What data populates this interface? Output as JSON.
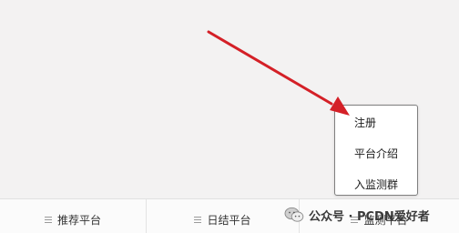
{
  "popup_menu": {
    "items": [
      {
        "label": "注册"
      },
      {
        "label": "平台介绍"
      },
      {
        "label": "入监测群"
      }
    ]
  },
  "bottom_bar": {
    "tabs": [
      {
        "label": "推荐平台",
        "icon": "menu-icon"
      },
      {
        "label": "日结平台",
        "icon": "menu-icon"
      },
      {
        "label": "监测平台",
        "icon": "menu-icon"
      }
    ]
  },
  "watermark": {
    "text": "公众号 · PCDN爱好者"
  },
  "colors": {
    "arrow": "#d42027",
    "background": "#f3f2f2",
    "bar_background": "#fbfbfb",
    "menu_border": "#7f7f7f"
  }
}
